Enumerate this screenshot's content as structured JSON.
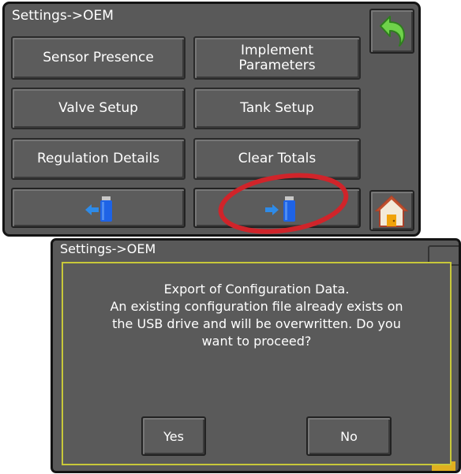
{
  "top_screen": {
    "title": "Settings->OEM",
    "buttons": {
      "sensor_presence": "Sensor Presence",
      "implement_parameters_line1": "Implement",
      "implement_parameters_line2": "Parameters",
      "valve_setup": "Valve Setup",
      "tank_setup": "Tank Setup",
      "regulation_details": "Regulation Details",
      "clear_totals": "Clear Totals"
    },
    "icons": {
      "back": "back-arrow-icon",
      "import": "usb-import-icon",
      "export": "usb-export-icon",
      "home": "home-icon"
    },
    "highlight_color": "#d0242a"
  },
  "bottom_screen": {
    "title": "Settings->OEM",
    "dialog": {
      "message_lines": [
        "Export of Configuration Data.",
        "An existing configuration file already exists on",
        "the USB drive and will be overwritten. Do you",
        "want to proceed?"
      ],
      "yes_label": "Yes",
      "no_label": "No",
      "border_color": "#c8c83a"
    }
  }
}
